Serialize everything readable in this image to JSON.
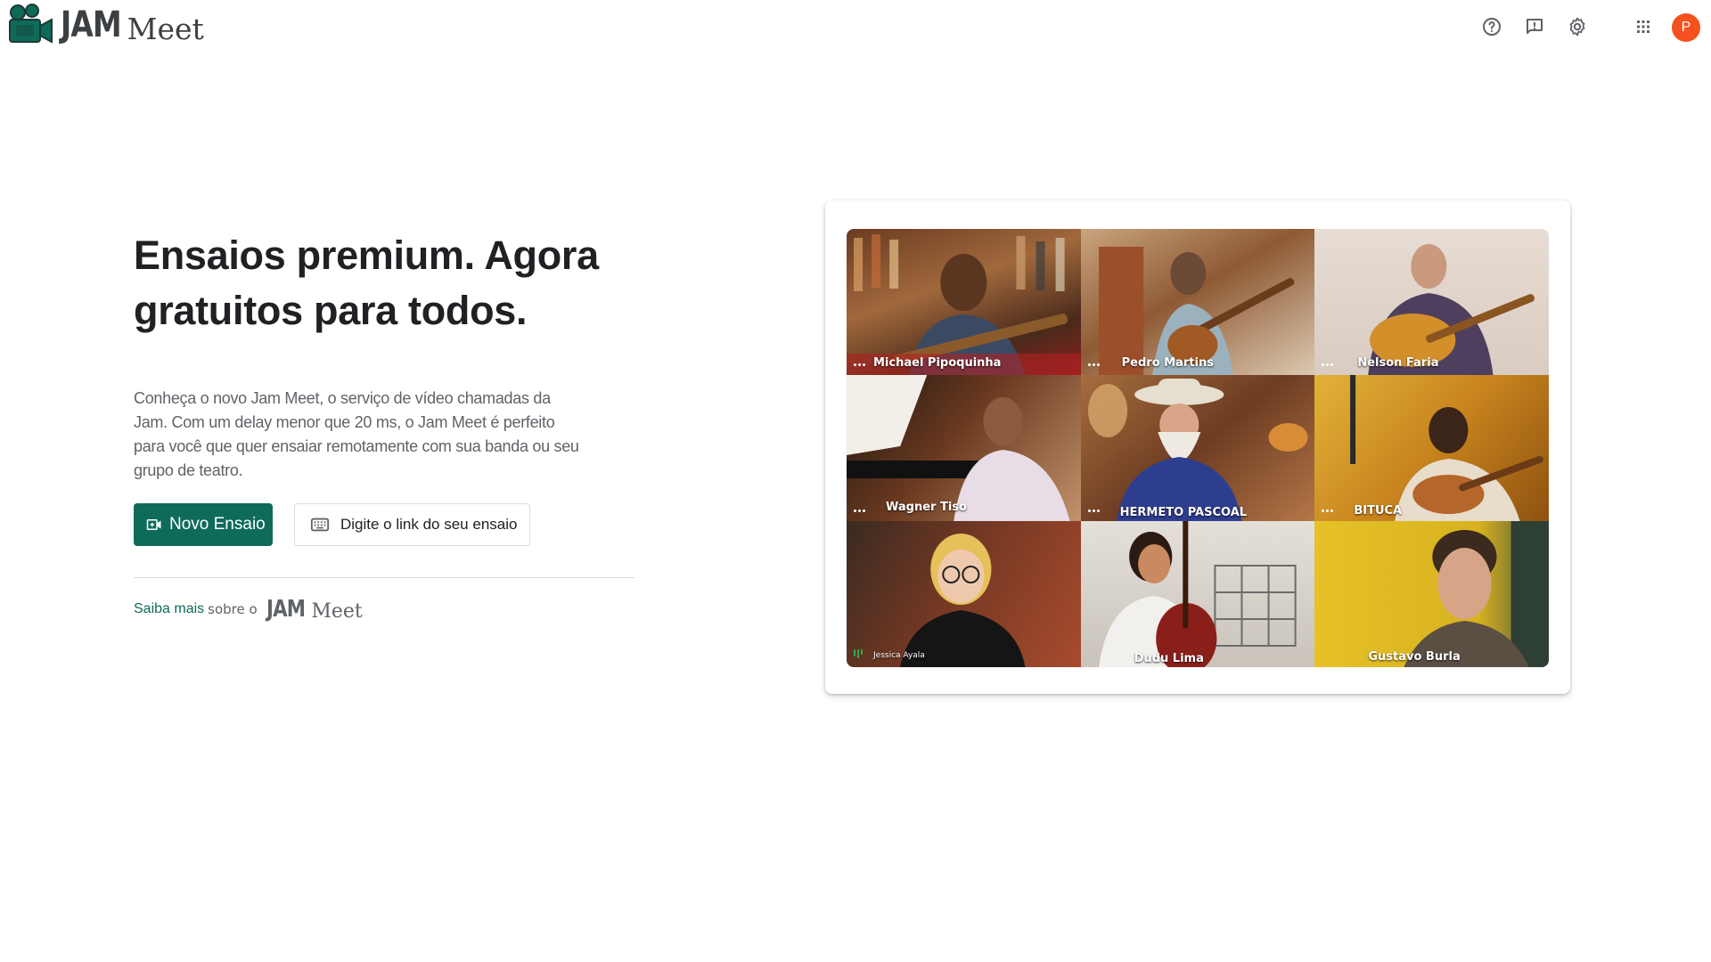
{
  "header": {
    "logo_jam": "JAM",
    "logo_meet": "Meet",
    "icons": [
      "help-icon",
      "feedback-icon",
      "settings-icon",
      "apps-icon"
    ],
    "avatar_initial": "P",
    "avatar_color": "#f4511e"
  },
  "main": {
    "headline": "Ensaios premium. Agora gratuitos para todos.",
    "description": "Conheça o novo Jam Meet, o serviço de vídeo chamadas da Jam. Com um delay menor que 20 ms, o Jam Meet é perfeito para você que quer ensaiar  remotamente com sua banda ou seu grupo de teatro.",
    "new_button_label": "Novo Ensaio",
    "join_placeholder": "Digite o link do seu ensaio",
    "learn_more_link": "Saiba mais",
    "learn_more_about": "sobre o",
    "learn_more_jam": "JAM",
    "learn_more_meet": "Meet",
    "accent_color": "#0e6b5a"
  },
  "video_grid": {
    "participants": [
      {
        "name": "Michael Pipoquinha"
      },
      {
        "name": "Pedro Martins"
      },
      {
        "name": "Nelson Faria"
      },
      {
        "name": "Wagner Tiso"
      },
      {
        "name": "HERMETO PASCOAL"
      },
      {
        "name": "BITUCA"
      },
      {
        "name": "Jessica Ayala"
      },
      {
        "name": "Dudu Lima"
      },
      {
        "name": "Gustavo Burla"
      }
    ]
  }
}
